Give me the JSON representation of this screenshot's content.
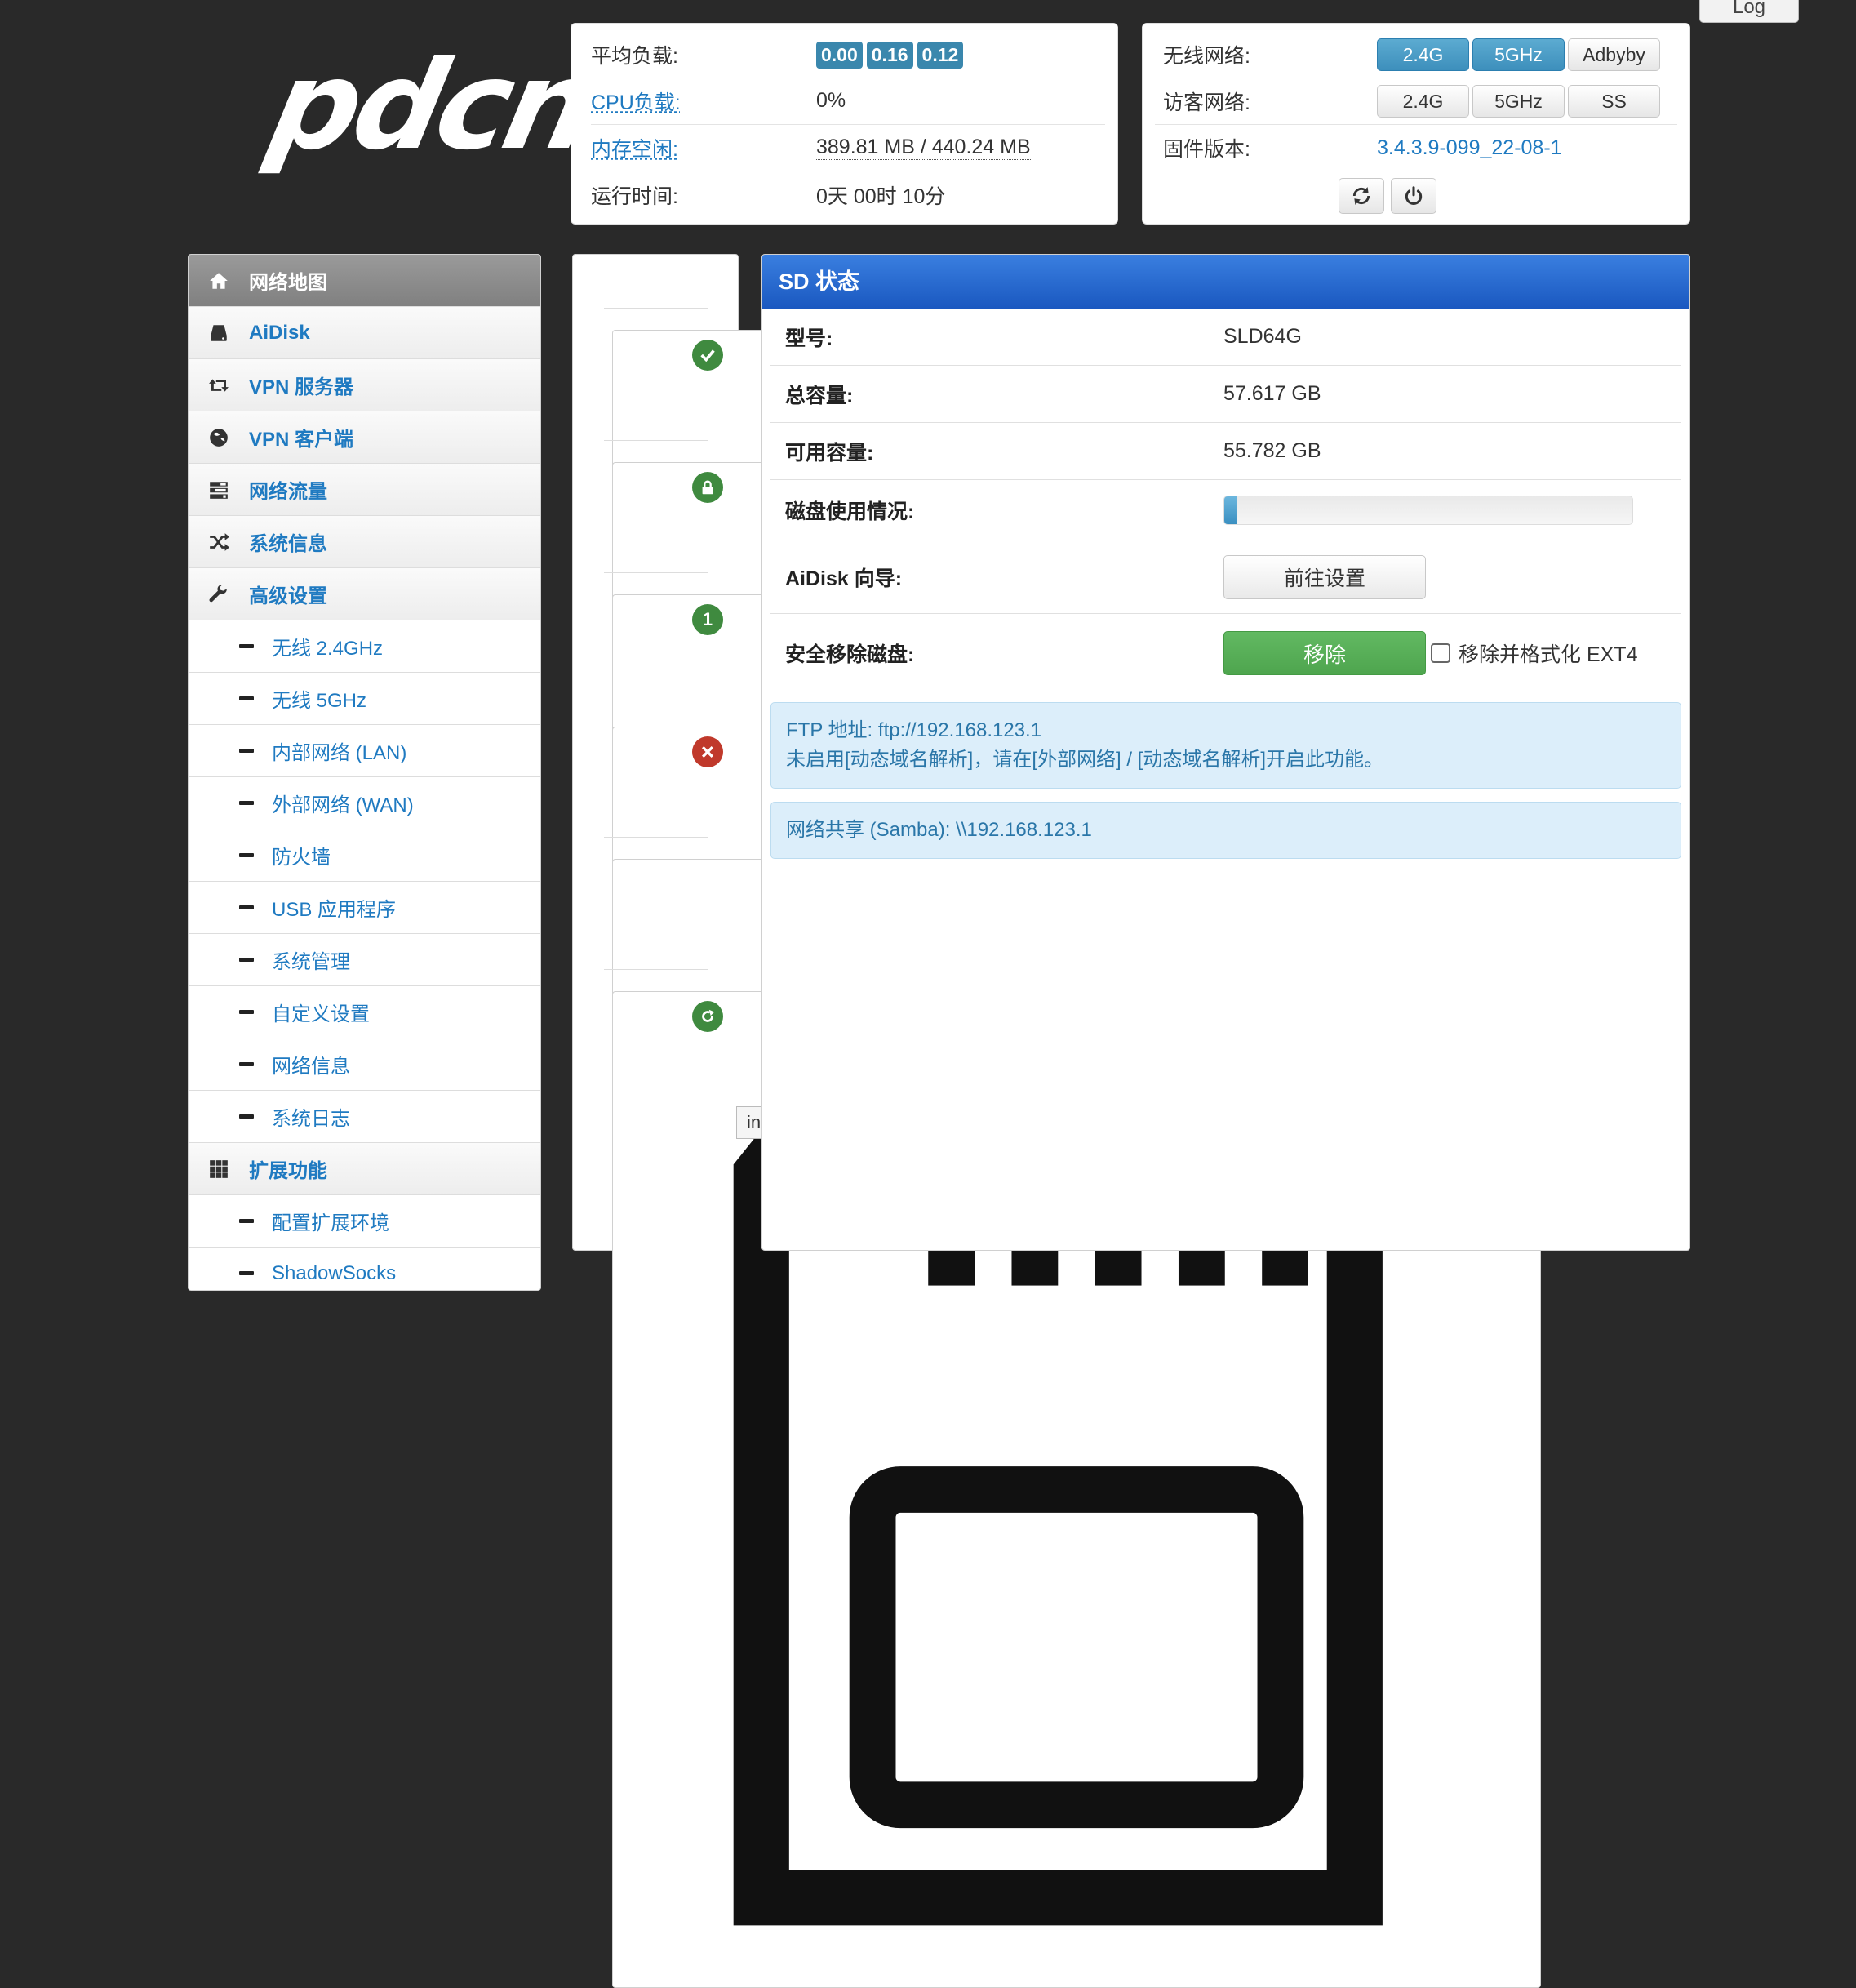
{
  "logo": {
    "text": "pdcn"
  },
  "log_button": "Log",
  "status": {
    "avg_load_label": "平均负载:",
    "avg_load": [
      "0.00",
      "0.16",
      "0.12"
    ],
    "cpu_label": "CPU负载:",
    "cpu_value": "0%",
    "mem_label": "内存空闲:",
    "mem_value": "389.81 MB / 440.24 MB",
    "uptime_label": "运行时间:",
    "uptime_value": "0天 00时 10分"
  },
  "wifi": {
    "wireless_label": "无线网络:",
    "wireless_buttons": [
      "2.4G",
      "5GHz",
      "Adbyby"
    ],
    "guest_label": "访客网络:",
    "guest_buttons": [
      "2.4G",
      "5GHz",
      "SS"
    ],
    "firmware_label": "固件版本:",
    "firmware_value": "3.4.3.9-099_22-08-1",
    "refresh_icon": "refresh-icon",
    "power_icon": "power-icon"
  },
  "sidebar": {
    "items": [
      {
        "label": "网络地图",
        "icon": "home-icon",
        "type": "main",
        "active": true
      },
      {
        "label": "AiDisk",
        "icon": "hdd-icon",
        "type": "main"
      },
      {
        "label": "VPN 服务器",
        "icon": "retweet-icon",
        "type": "main"
      },
      {
        "label": "VPN 客户端",
        "icon": "globe-icon",
        "type": "main"
      },
      {
        "label": "网络流量",
        "icon": "tasks-icon",
        "type": "main"
      },
      {
        "label": "系统信息",
        "icon": "shuffle-icon",
        "type": "main"
      },
      {
        "label": "高级设置",
        "icon": "wrench-icon",
        "type": "main"
      },
      {
        "label": "无线 2.4GHz",
        "type": "sub"
      },
      {
        "label": "无线 5GHz",
        "type": "sub"
      },
      {
        "label": "内部网络 (LAN)",
        "type": "sub"
      },
      {
        "label": "外部网络 (WAN)",
        "type": "sub"
      },
      {
        "label": "防火墙",
        "type": "sub"
      },
      {
        "label": "USB 应用程序",
        "type": "sub"
      },
      {
        "label": "系统管理",
        "type": "sub"
      },
      {
        "label": "自定义设置",
        "type": "sub"
      },
      {
        "label": "网络信息",
        "type": "sub"
      },
      {
        "label": "系统日志",
        "type": "sub"
      },
      {
        "label": "扩展功能",
        "icon": "grid-icon",
        "type": "main"
      },
      {
        "label": "配置扩展环境",
        "type": "sub"
      },
      {
        "label": "ShadowSocks",
        "type": "sub"
      }
    ]
  },
  "iconcol": {
    "devices_badge": "1",
    "tooltip": "index.asp"
  },
  "sd": {
    "title": "SD 状态",
    "model_label": "型号:",
    "model_value": "SLD64G",
    "total_label": "总容量:",
    "total_value": "57.617 GB",
    "free_label": "可用容量:",
    "free_value": "55.782 GB",
    "usage_label": "磁盘使用情况:",
    "usage_fraction": 0.032,
    "aidisk_label": "AiDisk 向导:",
    "aidisk_button": "前往设置",
    "remove_label": "安全移除磁盘:",
    "remove_button": "移除",
    "format_checkbox": "移除并格式化 EXT4",
    "ftp_line": "FTP 地址: ftp://192.168.123.1",
    "ddns_line": "未启用[动态域名解析]，请在[外部网络] / [动态域名解析]开启此功能。",
    "samba_line": "网络共享 (Samba): \\\\192.168.123.1"
  },
  "colors": {
    "accent": "#1f7ac1",
    "header_blue": "#2563d0",
    "success_green": "#5cb85c",
    "info_bg": "#dceefa"
  }
}
